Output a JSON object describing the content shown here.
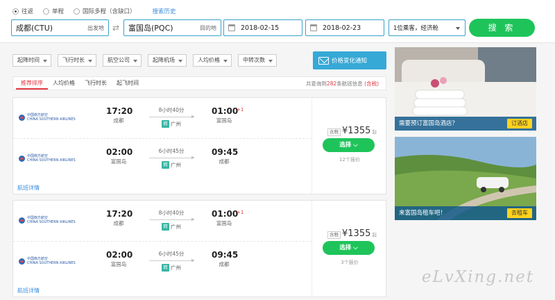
{
  "trip_types": [
    {
      "label": "往返",
      "checked": true
    },
    {
      "label": "单程",
      "checked": false
    },
    {
      "label": "国际多程（含缺口）",
      "checked": false
    }
  ],
  "history_label": "搜索历史",
  "search": {
    "from_value": "成都(CTU)",
    "from_tag": "出发地",
    "to_value": "富国岛(PQC)",
    "to_tag": "目的地",
    "depart_date": "2018-02-15",
    "return_date": "2018-02-23",
    "passengers": "1位乘客，经济舱",
    "search_label": "搜 索"
  },
  "filters": [
    "起降时间",
    "飞行时长",
    "航空公司",
    "起降机场",
    "人均价格",
    "中转次数"
  ],
  "notify_label": "价格变化通知",
  "sort_options": [
    "推荐排序",
    "人均价格",
    "飞行时长",
    "起飞时间"
  ],
  "total": {
    "prefix": "共查询到",
    "count": "282",
    "suffix": "条航班信息",
    "tax_note": "(含税)"
  },
  "airline": {
    "name_cn": "中国南方航空",
    "name_en": "CHINA SOUTHERN AIRLINES"
  },
  "transfer_badge": "转",
  "detail_label": "航班详情",
  "results": [
    {
      "outbound": {
        "dep_time": "17:20",
        "dep_city": "成都",
        "duration": "8小时40分",
        "via": "广州",
        "arr_time": "01:00",
        "arr_city": "富国岛",
        "next_day": "+1"
      },
      "inbound": {
        "dep_time": "02:00",
        "dep_city": "富国岛",
        "duration": "6小时45分",
        "via": "广州",
        "arr_time": "09:45",
        "arr_city": "成都"
      },
      "tax_label": "含税",
      "price": "¥1355",
      "price_suffix": "起",
      "select_label": "选择",
      "quotes": "12个报价"
    },
    {
      "outbound": {
        "dep_time": "17:20",
        "dep_city": "成都",
        "duration": "8小时40分",
        "via": "广州",
        "arr_time": "01:00",
        "arr_city": "富国岛",
        "next_day": "+1"
      },
      "inbound": {
        "dep_time": "02:00",
        "dep_city": "富国岛",
        "duration": "6小时45分",
        "via": "广州",
        "arr_time": "09:45",
        "arr_city": "成都"
      },
      "tax_label": "含税",
      "price": "¥1355",
      "price_suffix": "起",
      "select_label": "选择",
      "quotes": "3个报价"
    }
  ],
  "ads": [
    {
      "caption": "需要预订富国岛酒店？",
      "button": "订酒店"
    },
    {
      "caption": "来富国岛租车吧！",
      "button": "去租车"
    }
  ],
  "watermark": "eLvXing.net"
}
